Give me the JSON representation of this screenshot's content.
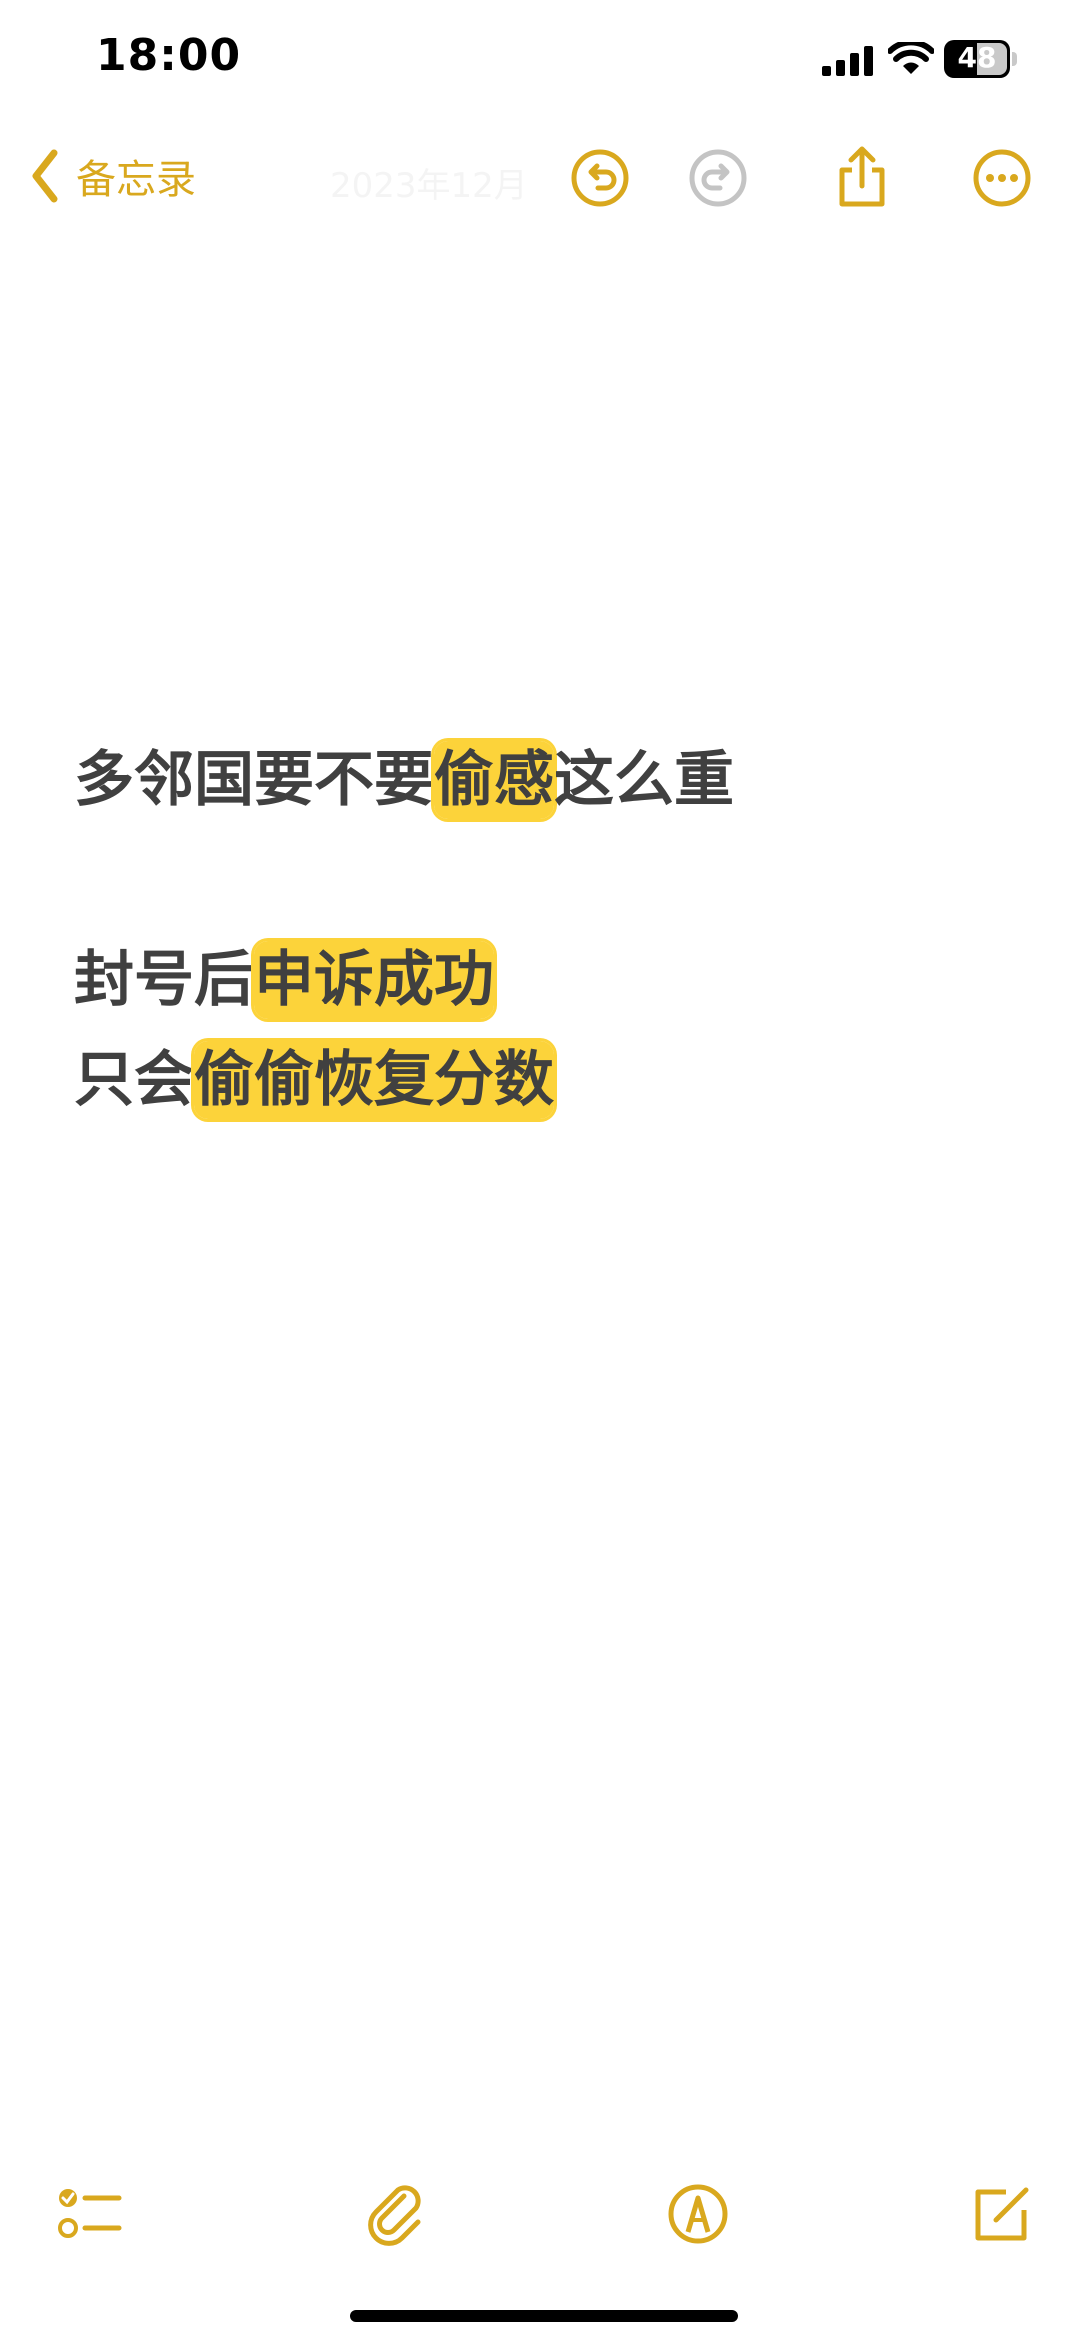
{
  "status_bar": {
    "time": "18:00",
    "battery": "48"
  },
  "nav": {
    "back_label": "备忘录",
    "title": "2023年12月",
    "icons": [
      "chevron-left-icon",
      "undo-icon",
      "redo-icon",
      "share-icon",
      "more-icon"
    ]
  },
  "note": {
    "line1": {
      "before": "多邻国要不要",
      "highlight": "偷感",
      "after": "这么重"
    },
    "line2": {
      "before": "封号后",
      "highlight": "申诉成功",
      "after": ""
    },
    "line3": {
      "before": "只会",
      "highlight": "偷偷恢复分数",
      "after": ""
    }
  },
  "toolbar": {
    "icons": [
      "checklist-icon",
      "paperclip-icon",
      "markup-pen-icon",
      "compose-icon"
    ]
  },
  "colors": {
    "accent": "#d9a81e",
    "highlight": "#fcd33a",
    "text": "#404040",
    "background": "#ffffff"
  }
}
